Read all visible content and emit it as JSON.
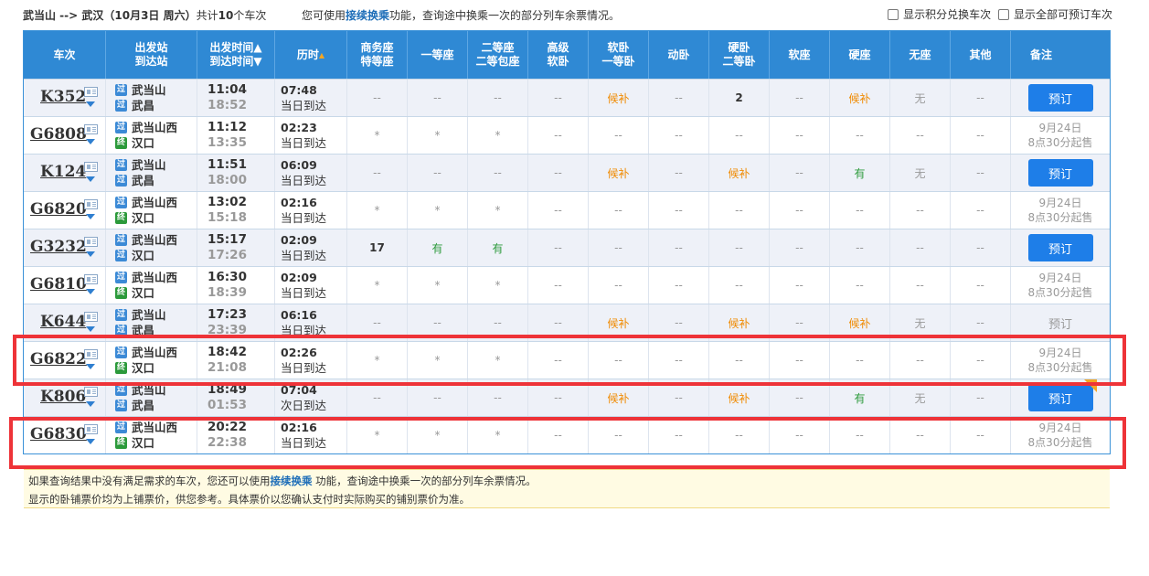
{
  "top": {
    "route": "武当山 --> 武汉（10月3日 周六）",
    "count_prefix": "共计",
    "count": "10",
    "count_suffix": "个车次",
    "tip_before": "您可使用",
    "tip_link": "接续换乘",
    "tip_after": "功能，查询途中换乘一次的部分列车余票情况。",
    "opt1": "显示积分兑换车次",
    "opt2": "显示全部可预订车次"
  },
  "headers": [
    {
      "l1": "车次",
      "l2": ""
    },
    {
      "l1": "出发站",
      "l2": "到达站"
    },
    {
      "l1": "出发时间▲",
      "l2": "到达时间▼"
    },
    {
      "l1": "历时",
      "l2": ""
    },
    {
      "l1": "商务座",
      "l2": "特等座"
    },
    {
      "l1": "一等座",
      "l2": ""
    },
    {
      "l1": "二等座",
      "l2": "二等包座"
    },
    {
      "l1": "高级",
      "l2": "软卧"
    },
    {
      "l1": "软卧",
      "l2": "一等卧"
    },
    {
      "l1": "动卧",
      "l2": ""
    },
    {
      "l1": "硬卧",
      "l2": "二等卧"
    },
    {
      "l1": "软座",
      "l2": ""
    },
    {
      "l1": "硬座",
      "l2": ""
    },
    {
      "l1": "无座",
      "l2": ""
    },
    {
      "l1": "其他",
      "l2": ""
    },
    {
      "l1": "备注",
      "l2": ""
    }
  ],
  "trains": [
    {
      "code": "K352",
      "from": "武当山",
      "from_badge": "过",
      "to": "武昌",
      "to_badge": "过",
      "dep": "11:04",
      "arr": "18:52",
      "dur": "07:48",
      "day": "当日到达",
      "seats": [
        "--",
        "--",
        "--",
        "--",
        "候补",
        "--",
        "2",
        "--",
        "候补",
        "无",
        "--"
      ],
      "action": "预订",
      "action_type": "button"
    },
    {
      "code": "G6808",
      "from": "武当山西",
      "from_badge": "过",
      "to": "汉口",
      "to_badge": "终",
      "dep": "11:12",
      "arr": "13:35",
      "dur": "02:23",
      "day": "当日到达",
      "seats": [
        "*",
        "*",
        "*",
        "--",
        "--",
        "--",
        "--",
        "--",
        "--",
        "--",
        "--"
      ],
      "action": "9月24日",
      "action2": "8点30分起售",
      "action_type": "presale"
    },
    {
      "code": "K124",
      "from": "武当山",
      "from_badge": "过",
      "to": "武昌",
      "to_badge": "过",
      "dep": "11:51",
      "arr": "18:00",
      "dur": "06:09",
      "day": "当日到达",
      "seats": [
        "--",
        "--",
        "--",
        "--",
        "候补",
        "--",
        "候补",
        "--",
        "有",
        "无",
        "--"
      ],
      "action": "预订",
      "action_type": "button"
    },
    {
      "code": "G6820",
      "from": "武当山西",
      "from_badge": "过",
      "to": "汉口",
      "to_badge": "终",
      "dep": "13:02",
      "arr": "15:18",
      "dur": "02:16",
      "day": "当日到达",
      "seats": [
        "*",
        "*",
        "*",
        "--",
        "--",
        "--",
        "--",
        "--",
        "--",
        "--",
        "--"
      ],
      "action": "9月24日",
      "action2": "8点30分起售",
      "action_type": "presale"
    },
    {
      "code": "G3232",
      "from": "武当山西",
      "from_badge": "过",
      "to": "汉口",
      "to_badge": "过",
      "dep": "15:17",
      "arr": "17:26",
      "dur": "02:09",
      "day": "当日到达",
      "seats": [
        "17",
        "有",
        "有",
        "--",
        "--",
        "--",
        "--",
        "--",
        "--",
        "--",
        "--"
      ],
      "action": "预订",
      "action_type": "button"
    },
    {
      "code": "G6810",
      "from": "武当山西",
      "from_badge": "过",
      "to": "汉口",
      "to_badge": "终",
      "dep": "16:30",
      "arr": "18:39",
      "dur": "02:09",
      "day": "当日到达",
      "seats": [
        "*",
        "*",
        "*",
        "--",
        "--",
        "--",
        "--",
        "--",
        "--",
        "--",
        "--"
      ],
      "action": "9月24日",
      "action2": "8点30分起售",
      "action_type": "presale"
    },
    {
      "code": "K644",
      "from": "武当山",
      "from_badge": "过",
      "to": "武昌",
      "to_badge": "过",
      "dep": "17:23",
      "arr": "23:39",
      "dur": "06:16",
      "day": "当日到达",
      "seats": [
        "--",
        "--",
        "--",
        "--",
        "候补",
        "--",
        "候补",
        "--",
        "候补",
        "无",
        "--"
      ],
      "action": "预订",
      "action_type": "disabled"
    },
    {
      "code": "G6822",
      "from": "武当山西",
      "from_badge": "过",
      "to": "汉口",
      "to_badge": "终",
      "dep": "18:42",
      "arr": "21:08",
      "dur": "02:26",
      "day": "当日到达",
      "seats": [
        "*",
        "*",
        "*",
        "--",
        "--",
        "--",
        "--",
        "--",
        "--",
        "--",
        "--"
      ],
      "action": "9月24日",
      "action2": "8点30分起售",
      "action_type": "presale"
    },
    {
      "code": "K806",
      "from": "武当山",
      "from_badge": "过",
      "to": "武昌",
      "to_badge": "过",
      "dep": "18:49",
      "arr": "01:53",
      "dur": "07:04",
      "day": "次日到达",
      "seats": [
        "--",
        "--",
        "--",
        "--",
        "候补",
        "--",
        "候补",
        "--",
        "有",
        "无",
        "--"
      ],
      "action": "预订",
      "action_type": "button",
      "corner": true
    },
    {
      "code": "G6830",
      "from": "武当山西",
      "from_badge": "过",
      "to": "汉口",
      "to_badge": "终",
      "dep": "20:22",
      "arr": "22:38",
      "dur": "02:16",
      "day": "当日到达",
      "seats": [
        "*",
        "*",
        "*",
        "--",
        "--",
        "--",
        "--",
        "--",
        "--",
        "--",
        "--"
      ],
      "action": "9月24日",
      "action2": "8点30分起售",
      "action_type": "presale"
    }
  ],
  "note": {
    "line1_before": "如果查询结果中没有满足需求的车次，您还可以使用",
    "line1_link": "接续换乘",
    "line1_after": " 功能，查询途中换乘一次的部分列车余票情况。",
    "line2": "显示的卧铺票价均为上铺票价，供您参考。具体票价以您确认支付时实际购买的铺别票价为准。"
  },
  "colors": {
    "header": "#2f89d4",
    "button": "#1e7ee8",
    "highlight": "#ee3338",
    "waitlist": "#f08a00",
    "available": "#2c9a3b"
  }
}
